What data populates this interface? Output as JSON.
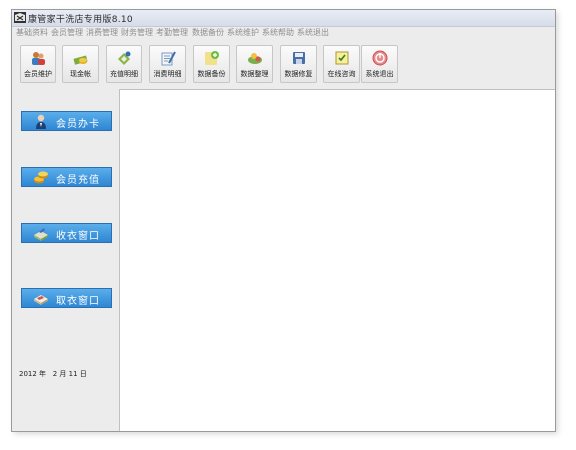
{
  "window": {
    "title": "康管家干洗店专用版8.10"
  },
  "menu": [
    "基础资料",
    "会员管理",
    "消费管理",
    "财务管理",
    "考勤管理",
    "数据备份",
    "系统维护",
    "系统帮助",
    "系统退出"
  ],
  "toolbar": [
    {
      "label": "会员维护",
      "icon": "members-icon"
    },
    {
      "label": "现金帐",
      "icon": "cash-icon"
    },
    {
      "label": "充值明细",
      "icon": "recharge-icon"
    },
    {
      "label": "消费明细",
      "icon": "consumption-icon"
    },
    {
      "label": "数据备份",
      "icon": "backup-icon"
    },
    {
      "label": "数据整理",
      "icon": "organize-icon"
    },
    {
      "label": "数据修复",
      "icon": "repair-icon"
    },
    {
      "label": "在线咨询",
      "icon": "consult-icon"
    },
    {
      "label": "系统退出",
      "icon": "exit-icon"
    }
  ],
  "sidebar": [
    {
      "label": "会员办卡",
      "icon": "member-card-icon"
    },
    {
      "label": "会员充值",
      "icon": "coins-icon"
    },
    {
      "label": "收衣窗口",
      "icon": "receive-clothes-icon"
    },
    {
      "label": "取衣窗口",
      "icon": "pickup-clothes-icon"
    }
  ],
  "status": {
    "date": "2012 年   2 月 11 日"
  },
  "colors": {
    "sidebar_button": "#3a8fdb",
    "menu_text": "#8e8e8e",
    "content_bg": "#ffffff"
  }
}
